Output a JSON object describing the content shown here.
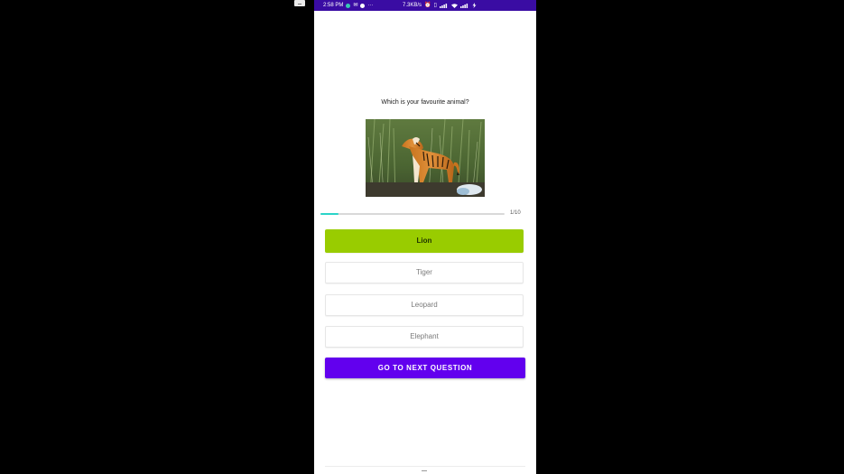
{
  "status_bar": {
    "time": "2:58 PM",
    "overflow": "···",
    "speed": "7.3KB/s",
    "background_color": "#3a0ca3"
  },
  "quiz": {
    "question": "Which is your favourite animal?",
    "image_icon": "tiger-photo",
    "progress": {
      "current": 1,
      "total": 10,
      "label": "1/10",
      "fraction": 0.1,
      "color": "#2ad4c8"
    },
    "options": [
      {
        "label": "Lion",
        "selected": true
      },
      {
        "label": "Tiger",
        "selected": false
      },
      {
        "label": "Leopard",
        "selected": false
      },
      {
        "label": "Elephant",
        "selected": false
      }
    ],
    "selected_color": "#99cc00",
    "next_button_label": "GO TO NEXT QUESTION",
    "next_button_color": "#6200ee"
  }
}
